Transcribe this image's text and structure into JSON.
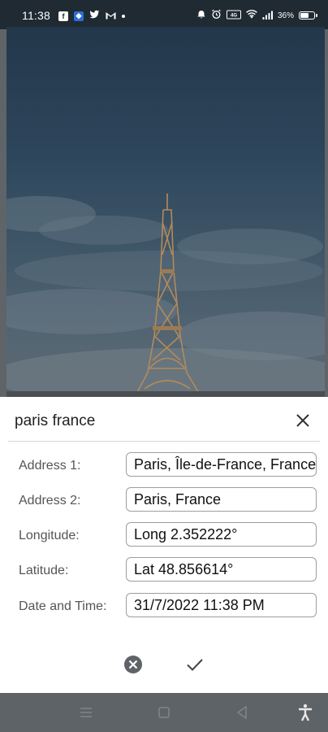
{
  "status_bar": {
    "time": "11:38",
    "battery_percent": "36%",
    "left_icons": [
      "facebook-icon",
      "messenger-icon",
      "twitter-icon",
      "gmail-icon",
      "notification-dot"
    ],
    "right_icons": [
      "alarm-icon",
      "clock-icon",
      "data-icon",
      "wifi-icon",
      "signal-icon",
      "battery-icon"
    ]
  },
  "photo": {
    "subject_icon": "eiffel-tower-photo"
  },
  "sheet": {
    "title": "paris france",
    "fields": [
      {
        "label": "Address 1:",
        "value": "Paris, Île-de-France, France"
      },
      {
        "label": "Address 2:",
        "value": "Paris, France"
      },
      {
        "label": "Longitude:",
        "value": "Long 2.352222°"
      },
      {
        "label": "Latitude:",
        "value": "Lat 48.856614°"
      },
      {
        "label": "Date and Time:",
        "value": " 31/7/2022 11:38 PM"
      }
    ],
    "actions": [
      "cancel-icon",
      "check-icon"
    ]
  },
  "nav_bar": {
    "buttons": [
      "menu-icon",
      "home-icon",
      "back-icon",
      "accessibility-icon"
    ]
  },
  "colors": {
    "sheet_bg": "#ffffff",
    "input_border": "#9e9e9e",
    "label_text": "#555555",
    "nav_bg": "#5d6367"
  }
}
